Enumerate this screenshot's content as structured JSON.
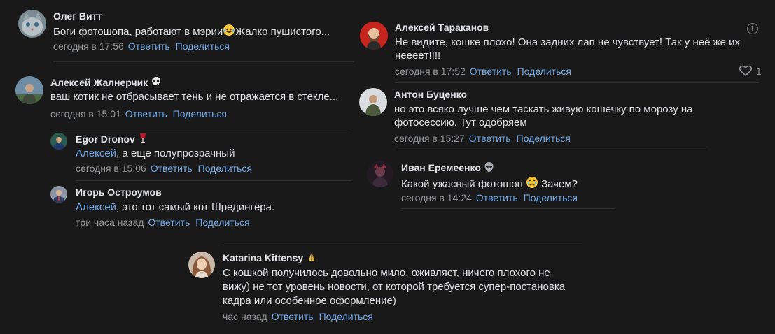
{
  "actions": {
    "reply": "Ответить",
    "share": "Поделиться"
  },
  "comments": [
    {
      "author": "Олег Витт",
      "text": "Боги фотошопа, работают в мэрии",
      "text_tail": "Жалко пушистого...",
      "time": "сегодня в 17:56"
    },
    {
      "author": "Алексей Жалнерчик",
      "text": "ваш котик не отбрасывает тень и не отражается в стекле...",
      "time": "сегодня в 15:01"
    },
    {
      "author": "Egor Dronov",
      "mention": "Алексей",
      "text": ", а еще полупрозрачный",
      "time": "сегодня в 15:06"
    },
    {
      "author": "Игорь Остроумов",
      "mention": "Алексей",
      "text": ", это тот самый кот Шредингёра.",
      "time": "три часа назад"
    },
    {
      "author": "Алексей Тараканов",
      "text_lines": [
        "Не видите, кошке плохо! Она задних лап не чувствует! Так у неё же их",
        "нееeeт!!!!"
      ],
      "time": "сегодня в 17:52",
      "likes": "1"
    },
    {
      "author": "Антон Буценко",
      "text_lines": [
        "но это всяко лучше чем таскать живую кошечку по морозу на",
        "фотосессию. Тут одобряем"
      ],
      "time": "сегодня в 15:27"
    },
    {
      "author": "Иван Еремеенко",
      "text": "Какой ужасный фотошоп",
      "text_tail": "Зачем?",
      "time": "сегодня в 14:24"
    },
    {
      "author": "Katarina Kittensy",
      "text_lines": [
        "С кошкой получилось довольно мило, оживляет, ничего плохого не",
        "вижу) не тот уровень новости, от которой требуется супер-постановка",
        "кадра или особенное оформление)"
      ],
      "time": "час назад"
    }
  ]
}
